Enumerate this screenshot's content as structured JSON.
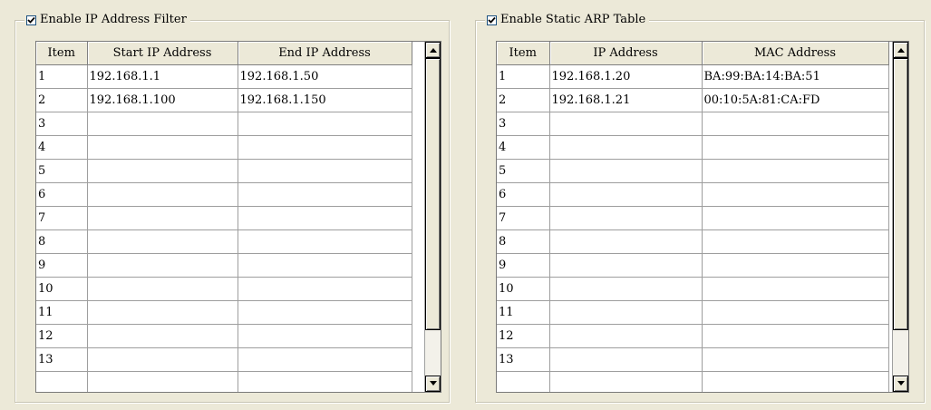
{
  "ip_filter": {
    "checkbox_label": "Enable IP Address Filter",
    "checked": true,
    "columns": [
      "Item",
      "Start IP Address",
      "End IP Address"
    ],
    "rows": [
      [
        "1",
        "192.168.1.1",
        "192.168.1.50"
      ],
      [
        "2",
        "192.168.1.100",
        "192.168.1.150"
      ],
      [
        "3",
        "",
        ""
      ],
      [
        "4",
        "",
        ""
      ],
      [
        "5",
        "",
        ""
      ],
      [
        "6",
        "",
        ""
      ],
      [
        "7",
        "",
        ""
      ],
      [
        "8",
        "",
        ""
      ],
      [
        "9",
        "",
        ""
      ],
      [
        "10",
        "",
        ""
      ],
      [
        "11",
        "",
        ""
      ],
      [
        "12",
        "",
        ""
      ],
      [
        "13",
        "",
        ""
      ],
      [
        "",
        "",
        ""
      ]
    ]
  },
  "arp_table": {
    "checkbox_label": "Enable Static ARP Table",
    "checked": true,
    "columns": [
      "Item",
      "IP Address",
      "MAC Address"
    ],
    "rows": [
      [
        "1",
        "192.168.1.20",
        "BA:99:BA:14:BA:51"
      ],
      [
        "2",
        "192.168.1.21",
        "00:10:5A:81:CA:FD"
      ],
      [
        "3",
        "",
        ""
      ],
      [
        "4",
        "",
        ""
      ],
      [
        "5",
        "",
        ""
      ],
      [
        "6",
        "",
        ""
      ],
      [
        "7",
        "",
        ""
      ],
      [
        "8",
        "",
        ""
      ],
      [
        "9",
        "",
        ""
      ],
      [
        "10",
        "",
        ""
      ],
      [
        "11",
        "",
        ""
      ],
      [
        "12",
        "",
        ""
      ],
      [
        "13",
        "",
        ""
      ],
      [
        "",
        "",
        ""
      ]
    ]
  },
  "colors": {
    "background": "#ece9d8",
    "checkbox_border": "#1c5180",
    "check_mark": "#21a121"
  }
}
